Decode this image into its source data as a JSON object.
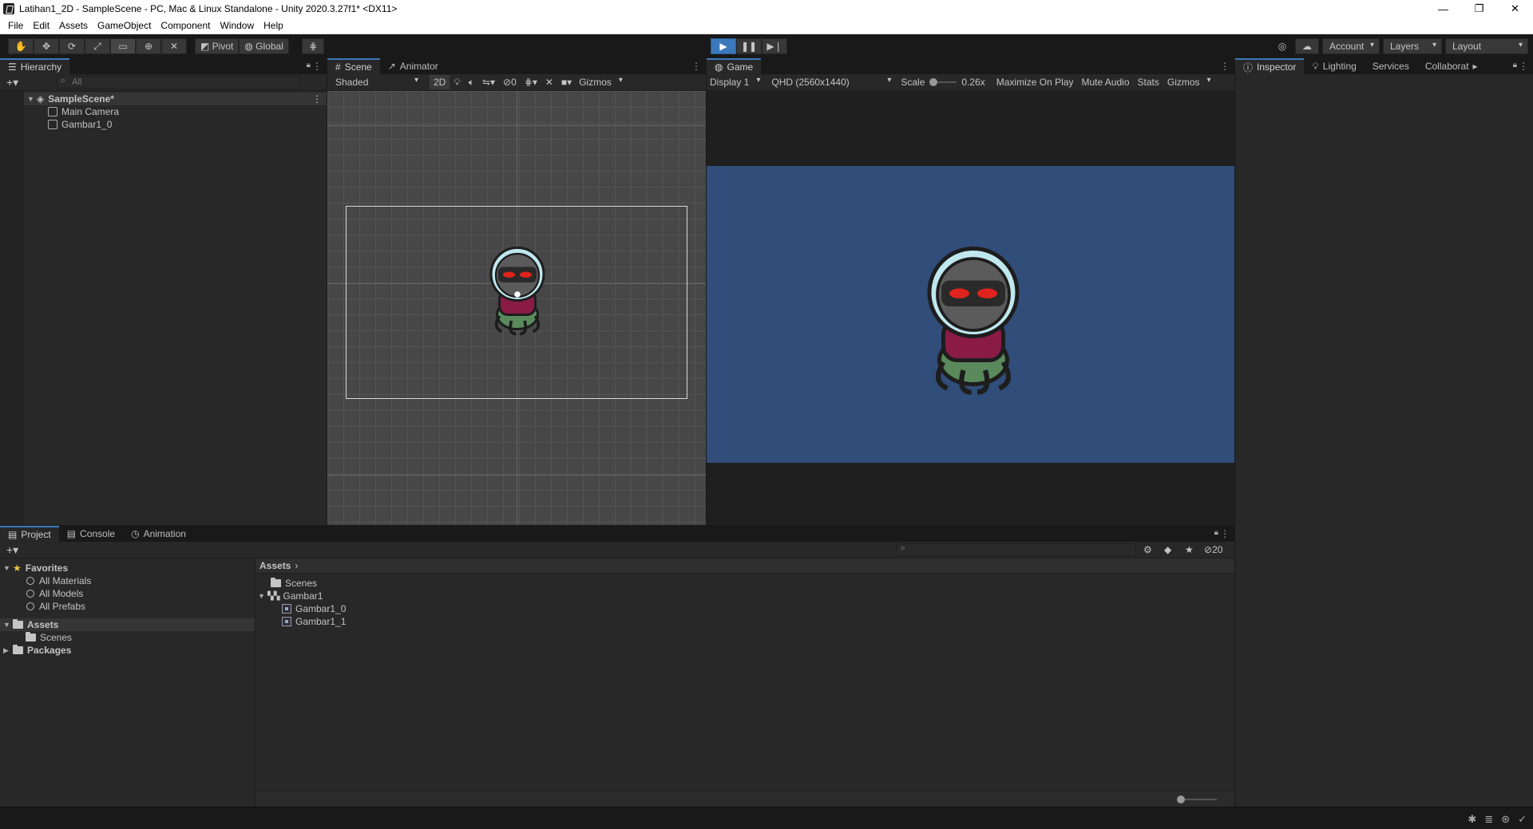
{
  "window": {
    "title": "Latihan1_2D - SampleScene - PC, Mac & Linux Standalone - Unity 2020.3.27f1* <DX11>",
    "minimize": "—",
    "maximize": "❐",
    "close": "✕"
  },
  "menu": [
    "File",
    "Edit",
    "Assets",
    "GameObject",
    "Component",
    "Window",
    "Help"
  ],
  "toolbar": {
    "pivot": "Pivot",
    "global": "Global",
    "account": "Account",
    "layers": "Layers",
    "layout": "Layout"
  },
  "hierarchy": {
    "tab": "Hierarchy",
    "search_placeholder": "All",
    "scene": "SampleScene*",
    "items": [
      "Main Camera",
      "Gambar1_0"
    ]
  },
  "scene_view": {
    "tabs": [
      "Scene",
      "Animator"
    ],
    "shading": "Shaded",
    "mode_2d": "2D",
    "hidden_count": "0",
    "gizmos": "Gizmos"
  },
  "game_view": {
    "tab": "Game",
    "display": "Display 1",
    "resolution": "QHD (2560x1440)",
    "scale_label": "Scale",
    "scale_value": "0.26x",
    "maximize_on_play": "Maximize On Play",
    "mute_audio": "Mute Audio",
    "stats": "Stats",
    "gizmos": "Gizmos",
    "background_color": "#314d79"
  },
  "inspector": {
    "tabs": [
      "Inspector",
      "Lighting",
      "Services",
      "Collaborat"
    ]
  },
  "project": {
    "tabs": [
      "Project",
      "Console",
      "Animation"
    ],
    "favorites": {
      "label": "Favorites",
      "items": [
        "All Materials",
        "All Models",
        "All Prefabs"
      ]
    },
    "assets_label": "Assets",
    "assets_children": [
      "Scenes"
    ],
    "packages_label": "Packages",
    "breadcrumb": "Assets",
    "hidden_count": "20",
    "content": {
      "scenes": "Scenes",
      "gambar1": "Gambar1",
      "sprites": [
        "Gambar1_0",
        "Gambar1_1"
      ]
    }
  },
  "colors": {
    "accent": "#3a79bb",
    "panel_bg": "#282828",
    "game_bg": "#314d79"
  }
}
